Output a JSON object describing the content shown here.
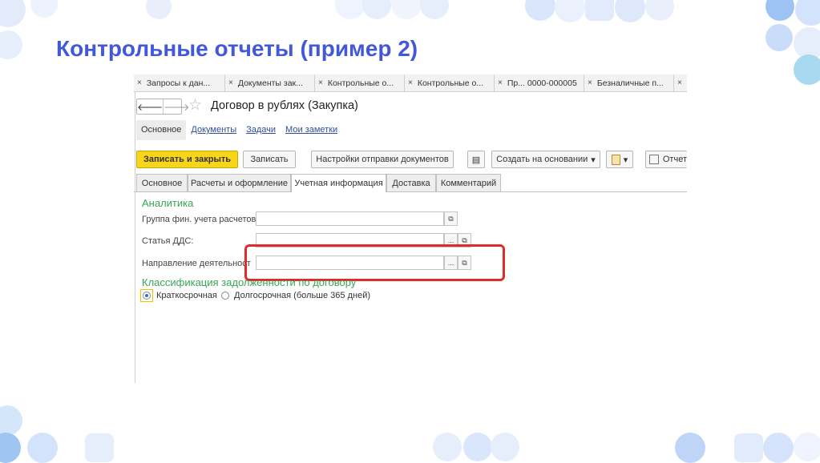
{
  "slide": {
    "title": "Контрольные отчеты (пример 2)"
  },
  "open_tabs": [
    {
      "label": "Запросы к дан..."
    },
    {
      "label": "Документы зак..."
    },
    {
      "label": "Контрольные о..."
    },
    {
      "label": "Контрольные о..."
    },
    {
      "label": "Пр... 0000-000005"
    },
    {
      "label": "Безналичные п..."
    }
  ],
  "form": {
    "title": "Договор в рублях (Закупка)",
    "section_tabs": [
      {
        "label": "Основное"
      },
      {
        "label": "Документы"
      },
      {
        "label": "Задачи"
      },
      {
        "label": "Мои заметки"
      }
    ],
    "toolbar": {
      "save_close": "Записать и закрыть",
      "save": "Записать",
      "send_settings": "Настройки отправки документов",
      "create_based": "Создать на основании",
      "report": "Отчет"
    },
    "form_tabs": [
      {
        "label": "Основное"
      },
      {
        "label": "Расчеты и оформление"
      },
      {
        "label": "Учетная информация"
      },
      {
        "label": "Доставка"
      },
      {
        "label": "Комментарий"
      }
    ],
    "analytics": {
      "heading": "Аналитика",
      "fin_group_label": "Группа фин. учета расчетов:",
      "fin_group_value": "",
      "dds_label": "Статья ДДС:",
      "dds_value": "",
      "activity_label": "Направление деятельност",
      "activity_value": ""
    },
    "debt": {
      "heading": "Классификация задолженности по договору",
      "short_term": "Краткосрочная",
      "long_term": "Долгосрочная (больше 365 дней)",
      "selected": "Краткосрочная"
    },
    "icons": {
      "dots": "...",
      "open": "⧉",
      "back": "🡐",
      "forward": "🡒",
      "star": "☆",
      "dropdown": "▾",
      "list": "▤",
      "close": "×"
    }
  },
  "colors": {
    "title": "#4357d9",
    "primary_button": "#f8d41a",
    "group_heading": "#3aa55a",
    "highlight": "#e02b2b",
    "link": "#2c4e9b"
  }
}
